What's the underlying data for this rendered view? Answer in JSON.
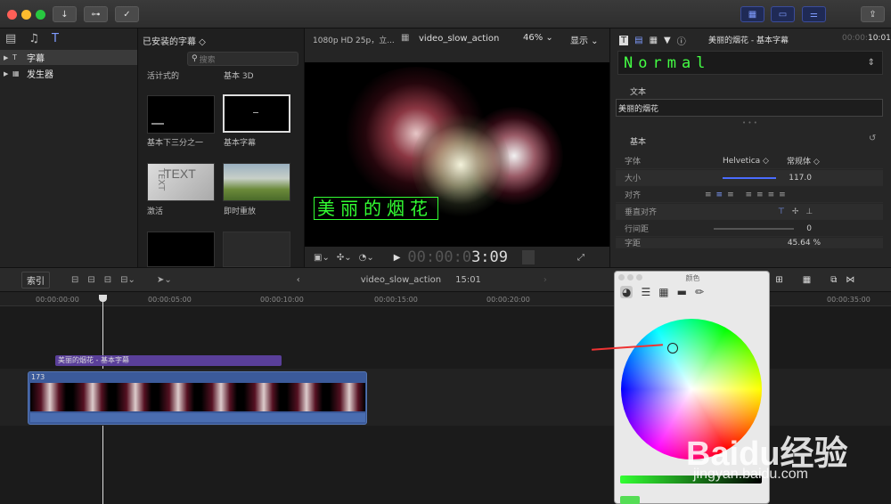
{
  "toolbar": {
    "import_icon": "↓",
    "key_icon": "⊶",
    "check_icon": "✓",
    "view_icons": [
      "▦",
      "▭",
      "⚌"
    ],
    "share_icon": "⇪"
  },
  "sidebar": {
    "items": [
      {
        "label": "字幕",
        "icon": "T"
      },
      {
        "label": "发生器",
        "icon": "▦"
      }
    ]
  },
  "browser": {
    "header": "已安装的字幕 ◇",
    "search_placeholder": "搜索",
    "items": [
      {
        "label": "活计式的"
      },
      {
        "label": "基本 3D"
      },
      {
        "label": "基本下三分之一"
      },
      {
        "label": "基本字幕"
      },
      {
        "label": "激活"
      },
      {
        "label": "即时重放"
      }
    ]
  },
  "viewer": {
    "format": "1080p HD 25p，立...",
    "clip_name": "video_slow_action",
    "zoom": "46%",
    "display_menu": "显示",
    "overlay_text": "美丽的烟花",
    "timecode_dim": "00:00:0",
    "timecode": "3:09"
  },
  "inspector": {
    "title": "美丽的烟花 - 基本字幕",
    "duration_dim": "00:00:",
    "duration": "10:01",
    "preset": "Normal",
    "text_section": "文本",
    "text_value": "美丽的烟花",
    "basic_section": "基本",
    "rows": [
      {
        "label": "字体",
        "value": "Helvetica ◇",
        "value2": "常规体 ◇"
      },
      {
        "label": "大小",
        "value": "117.0"
      },
      {
        "label": "对齐",
        "value": ""
      },
      {
        "label": "垂直对齐",
        "value": ""
      },
      {
        "label": "行间距",
        "value": "0"
      },
      {
        "label": "字距",
        "value": "45.64 %"
      }
    ]
  },
  "timeline": {
    "index_label": "索引",
    "clip_name": "video_slow_action",
    "time": "15:01",
    "ruler": [
      "00:00:00:00",
      "00:00:05:00",
      "00:00:10:00",
      "00:00:15:00",
      "00:00:20:00",
      "00:00:35:00"
    ],
    "title_clip": "美丽的烟花 - 基本字幕",
    "video_clip_number": "173"
  },
  "color_panel": {
    "title": "颜色"
  },
  "watermark": {
    "brand": "Baidu经验",
    "url": "jingyan.baidu.com"
  }
}
